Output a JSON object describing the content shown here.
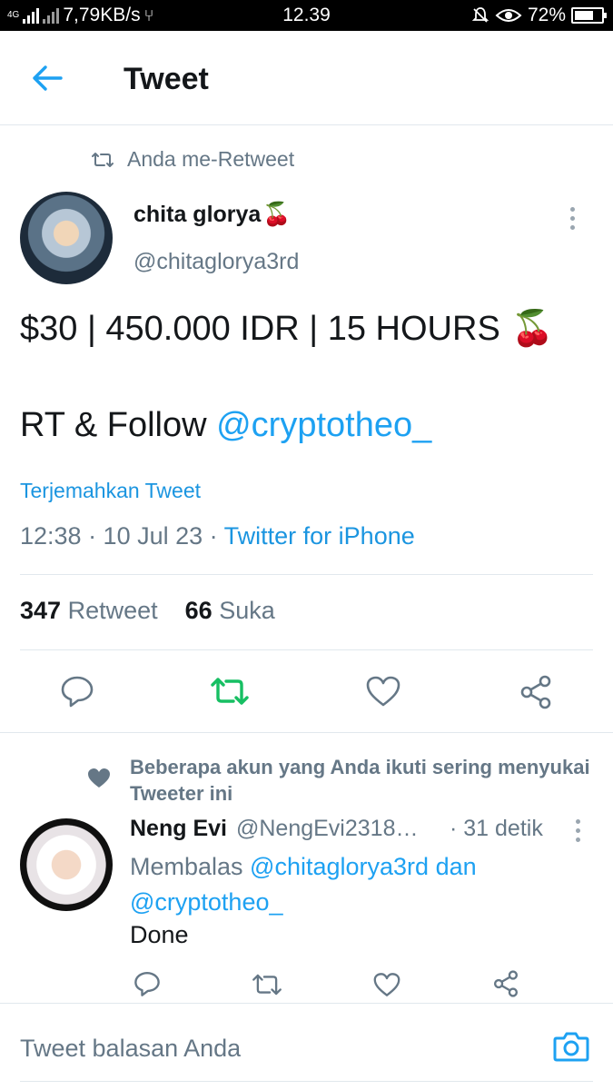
{
  "status_bar": {
    "network": "4G",
    "speed": "7,79KB/s",
    "time": "12.39",
    "battery": "72%"
  },
  "header": {
    "title": "Tweet"
  },
  "tweet": {
    "retweet_context": "Anda me-Retweet",
    "author_name": "chita glorya",
    "author_emoji": "🍒",
    "author_handle": "@chitaglorya3rd",
    "text_line1": "$30 | 450.000 IDR | 15 HOURS",
    "text_line1_emoji": "🍒",
    "text_line2_prefix": "RT & Follow ",
    "text_line2_mention": "@cryptotheo_",
    "translate_label": "Terjemahkan Tweet",
    "date_time": "12:38 · 10 Jul 23 · ",
    "source": "Twitter for iPhone",
    "retweet_count": "347",
    "retweet_label": "Retweet",
    "like_count": "66",
    "like_label": "Suka"
  },
  "reply": {
    "social_context": "Beberapa akun yang Anda ikuti sering menyukai Tweeter ini",
    "name": "Neng Evi",
    "handle": "@NengEvi2318…",
    "time": "· 31 detik",
    "replying_prefix": "Membalas ",
    "replying_mention1": "@chitaglorya3rd",
    "replying_and": " dan ",
    "replying_mention2": "@cryptotheo_",
    "text": "Done"
  },
  "composer": {
    "placeholder": "Tweet balasan Anda"
  },
  "colors": {
    "accent": "#1da1f2",
    "retweet_active": "#17bf63",
    "muted": "#657786"
  }
}
